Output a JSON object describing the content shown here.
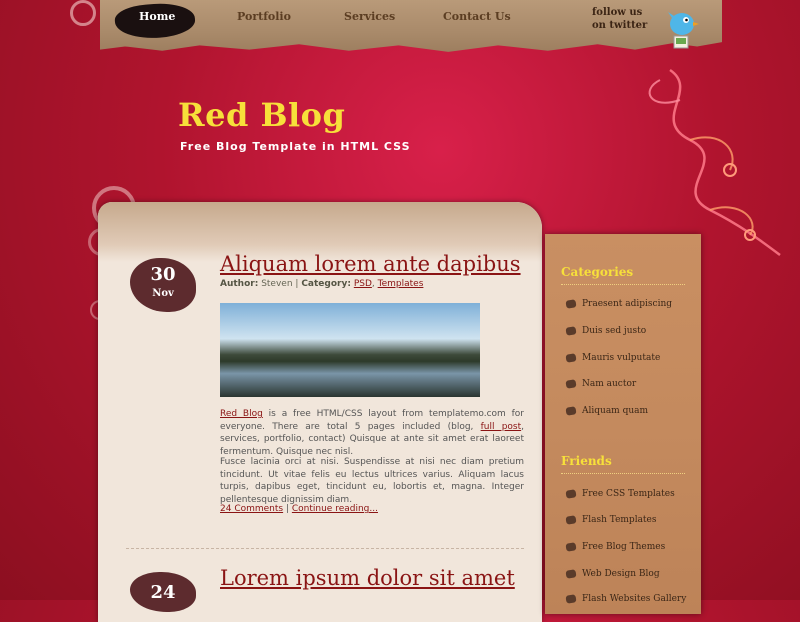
{
  "nav": {
    "items": [
      {
        "label": "Home",
        "active": true
      },
      {
        "label": "Portfolio",
        "active": false
      },
      {
        "label": "Services",
        "active": false
      },
      {
        "label": "Contact Us",
        "active": false
      }
    ],
    "twitter_text": "follow us on twitter"
  },
  "header": {
    "title": "Red Blog",
    "tagline": "Free Blog Template in HTML CSS"
  },
  "posts": [
    {
      "day": "30",
      "month": "Nov",
      "title": "Aliquam lorem ante dapibus",
      "author_label": "Author:",
      "author": "Steven",
      "category_label": "Category:",
      "categories": [
        "PSD",
        "Templates"
      ],
      "para1_link1": "Red Blog",
      "para1_text1": " is a free HTML/CSS layout from templatemo.com for everyone. There are total 5 pages included (blog, ",
      "para1_link2": "full post",
      "para1_text2": ", services, portfolio, contact) Quisque at ante sit amet erat laoreet fermentum. Quisque nec nisl.",
      "para2": "Fusce lacinia orci at nisi. Suspendisse at nisi nec diam pretium tincidunt. Ut vitae felis eu lectus ultrices varius. Aliquam lacus turpis, dapibus eget, tincidunt eu, lobortis et, magna. Integer pellentesque dignissim diam.",
      "comments": "24 Comments",
      "continue": "Continue reading..."
    },
    {
      "day": "24",
      "title": "Lorem ipsum dolor sit amet"
    }
  ],
  "sidebar": {
    "categories_heading": "Categories",
    "categories": [
      "Praesent adipiscing",
      "Duis sed justo",
      "Mauris vulputate",
      "Nam auctor",
      "Aliquam quam"
    ],
    "friends_heading": "Friends",
    "friends": [
      "Free CSS Templates",
      "Flash Templates",
      "Free Blog Themes",
      "Web Design Blog",
      "Flash Websites Gallery"
    ]
  },
  "colors": {
    "background": "#b0142e",
    "title_yellow": "#f7e03a",
    "link_red": "#8a1414",
    "sidebar": "#c48a5e",
    "content_paper": "#f1e6db"
  },
  "icons": [
    "twitter-bird-icon",
    "bullet-icon"
  ]
}
